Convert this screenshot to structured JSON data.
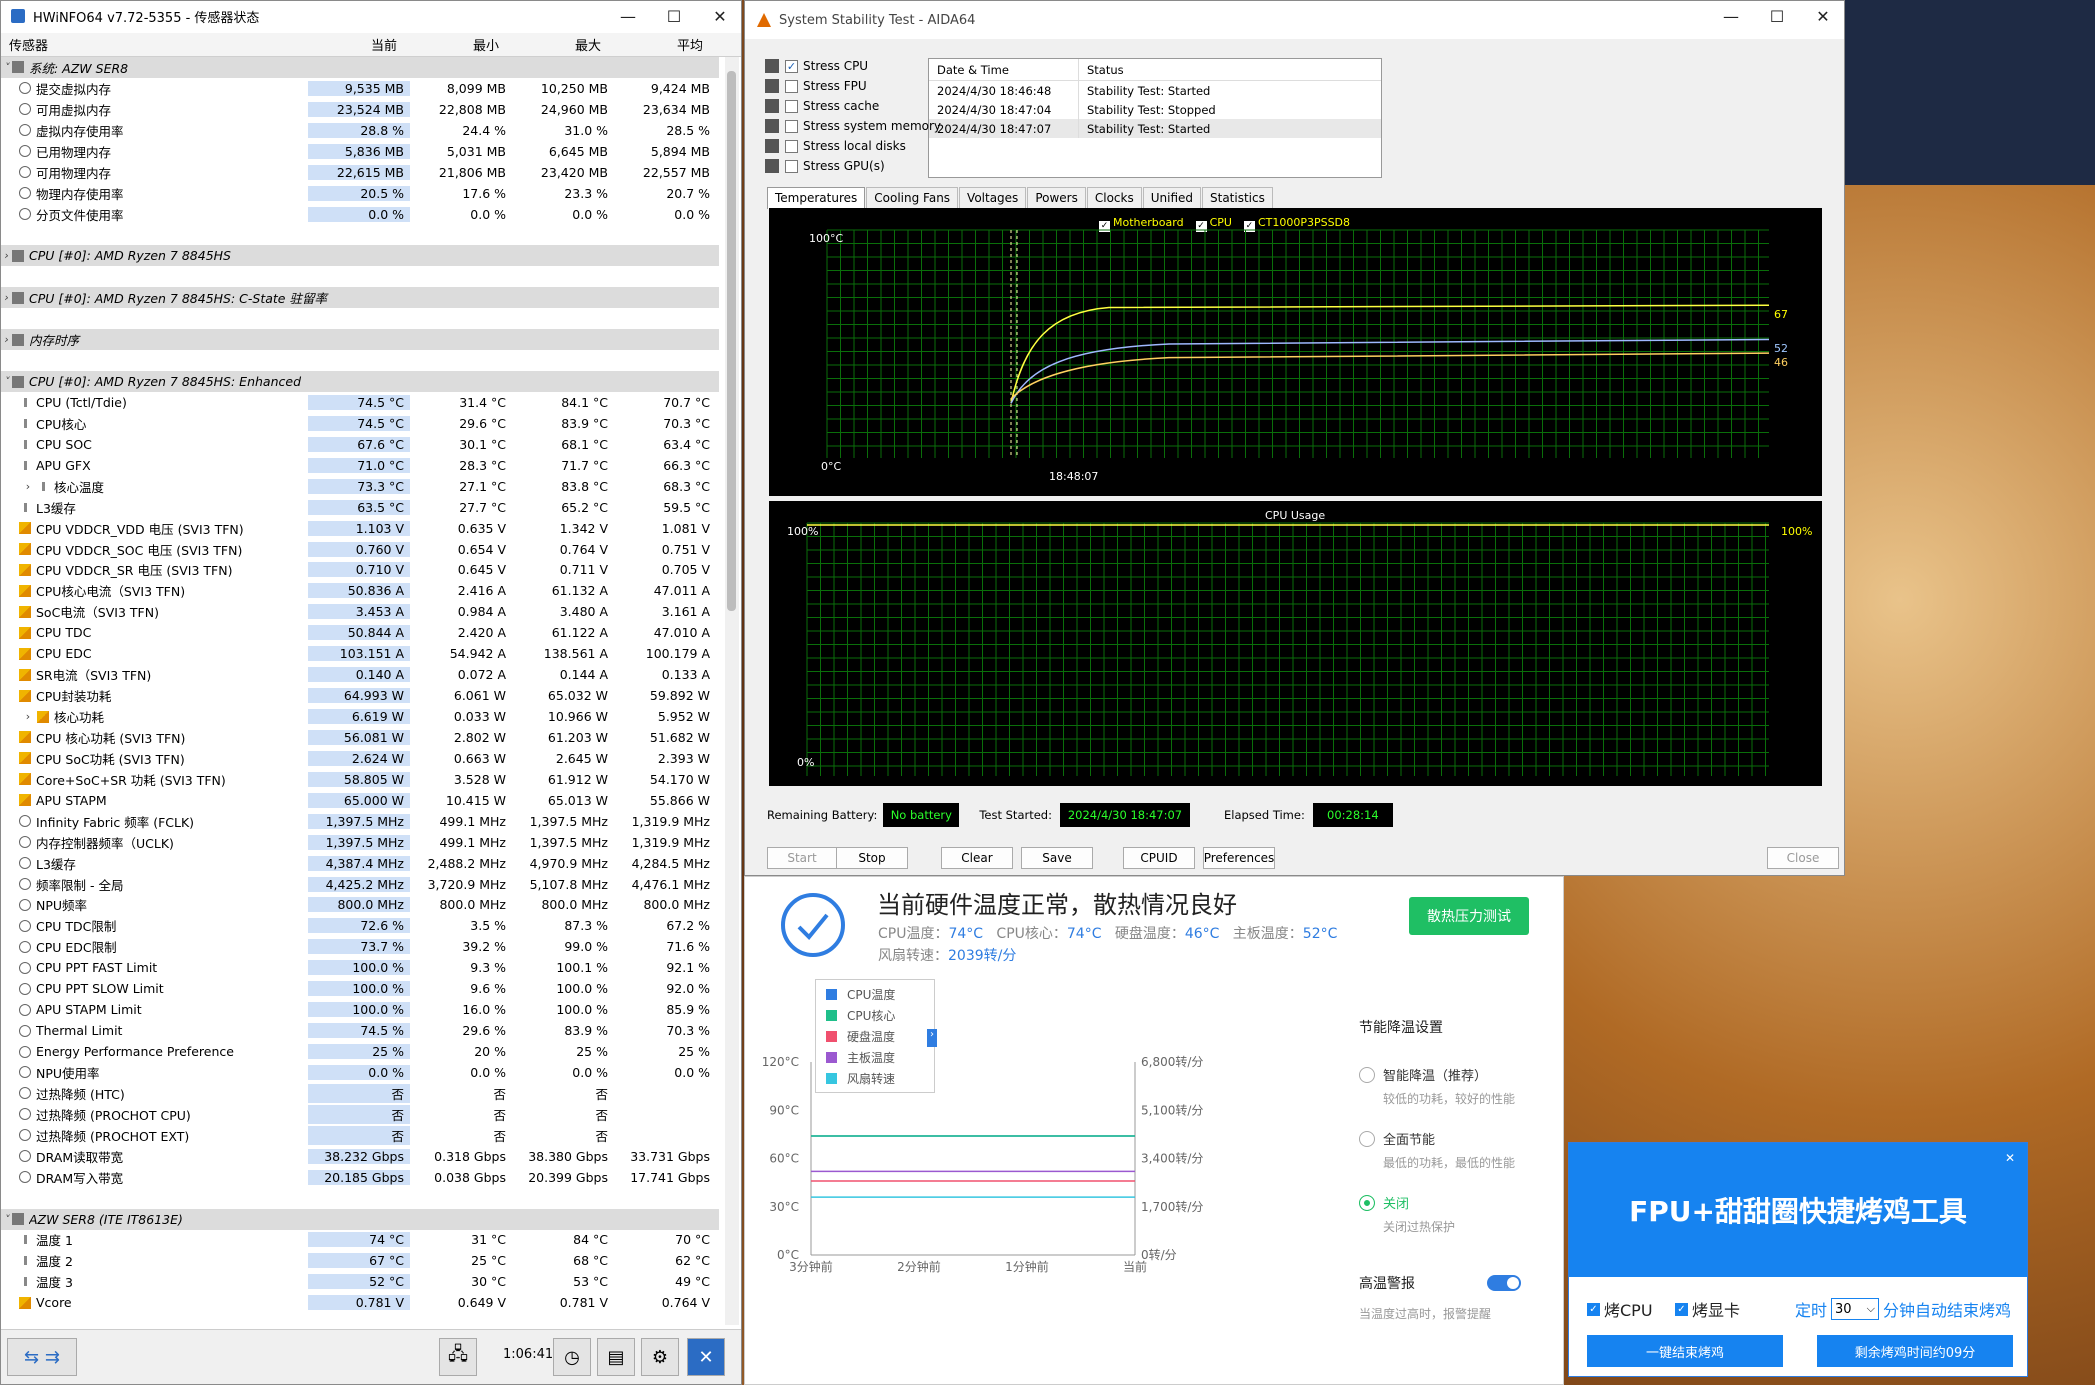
{
  "hwinfo": {
    "title": "HWiNFO64 v7.72-5355 - 传感器状态",
    "columns": {
      "sensor": "传感器",
      "current": "当前",
      "min": "最小",
      "max": "最大",
      "avg": "平均"
    },
    "rows": [
      {
        "type": "group",
        "expand": "˅",
        "name": "系统: AZW SER8"
      },
      {
        "type": "item",
        "icon": "circ",
        "name": "提交虚拟内存",
        "cur": "9,535 MB",
        "min": "8,099 MB",
        "max": "10,250 MB",
        "avg": "9,424 MB"
      },
      {
        "type": "item",
        "icon": "circ",
        "name": "可用虚拟内存",
        "cur": "23,524 MB",
        "min": "22,808 MB",
        "max": "24,960 MB",
        "avg": "23,634 MB"
      },
      {
        "type": "item",
        "icon": "circ",
        "name": "虚拟内存使用率",
        "cur": "28.8 %",
        "min": "24.4 %",
        "max": "31.0 %",
        "avg": "28.5 %"
      },
      {
        "type": "item",
        "icon": "circ",
        "name": "已用物理内存",
        "cur": "5,836 MB",
        "min": "5,031 MB",
        "max": "6,645 MB",
        "avg": "5,894 MB"
      },
      {
        "type": "item",
        "icon": "circ",
        "name": "可用物理内存",
        "cur": "22,615 MB",
        "min": "21,806 MB",
        "max": "23,420 MB",
        "avg": "22,557 MB"
      },
      {
        "type": "item",
        "icon": "circ",
        "name": "物理内存使用率",
        "cur": "20.5 %",
        "min": "17.6 %",
        "max": "23.3 %",
        "avg": "20.7 %"
      },
      {
        "type": "item",
        "icon": "circ",
        "name": "分页文件使用率",
        "cur": "0.0 %",
        "min": "0.0 %",
        "max": "0.0 %",
        "avg": "0.0 %"
      },
      {
        "type": "blank"
      },
      {
        "type": "group",
        "expand": "›",
        "name": "CPU [#0]: AMD Ryzen 7 8845HS"
      },
      {
        "type": "blank"
      },
      {
        "type": "group",
        "expand": "›",
        "name": "CPU [#0]: AMD Ryzen 7 8845HS: C-State 驻留率"
      },
      {
        "type": "blank"
      },
      {
        "type": "group",
        "expand": "›",
        "name": "内存时序"
      },
      {
        "type": "blank"
      },
      {
        "type": "group",
        "expand": "˅",
        "name": "CPU [#0]: AMD Ryzen 7 8845HS: Enhanced"
      },
      {
        "type": "item",
        "icon": "therm",
        "name": "CPU (Tctl/Tdie)",
        "cur": "74.5 °C",
        "min": "31.4 °C",
        "max": "84.1 °C",
        "avg": "70.7 °C"
      },
      {
        "type": "item",
        "icon": "therm",
        "name": "CPU核心",
        "cur": "74.5 °C",
        "min": "29.6 °C",
        "max": "83.9 °C",
        "avg": "70.3 °C"
      },
      {
        "type": "item",
        "icon": "therm",
        "name": "CPU SOC",
        "cur": "67.6 °C",
        "min": "30.1 °C",
        "max": "68.1 °C",
        "avg": "63.4 °C"
      },
      {
        "type": "item",
        "icon": "therm",
        "name": "APU GFX",
        "cur": "71.0 °C",
        "min": "28.3 °C",
        "max": "71.7 °C",
        "avg": "66.3 °C"
      },
      {
        "type": "item",
        "icon": "therm",
        "sub": true,
        "name": "核心温度",
        "cur": "73.3 °C",
        "min": "27.1 °C",
        "max": "83.8 °C",
        "avg": "68.3 °C"
      },
      {
        "type": "item",
        "icon": "therm",
        "name": "L3缓存",
        "cur": "63.5 °C",
        "min": "27.7 °C",
        "max": "65.2 °C",
        "avg": "59.5 °C"
      },
      {
        "type": "item",
        "icon": "bolt",
        "name": "CPU VDDCR_VDD 电压 (SVI3 TFN)",
        "cur": "1.103 V",
        "min": "0.635 V",
        "max": "1.342 V",
        "avg": "1.081 V"
      },
      {
        "type": "item",
        "icon": "bolt",
        "name": "CPU VDDCR_SOC 电压 (SVI3 TFN)",
        "cur": "0.760 V",
        "min": "0.654 V",
        "max": "0.764 V",
        "avg": "0.751 V"
      },
      {
        "type": "item",
        "icon": "bolt",
        "name": "CPU VDDCR_SR 电压 (SVI3 TFN)",
        "cur": "0.710 V",
        "min": "0.645 V",
        "max": "0.711 V",
        "avg": "0.705 V"
      },
      {
        "type": "item",
        "icon": "bolt",
        "name": "CPU核心电流（SVI3 TFN)",
        "cur": "50.836 A",
        "min": "2.416 A",
        "max": "61.132 A",
        "avg": "47.011 A"
      },
      {
        "type": "item",
        "icon": "bolt",
        "name": "SoC电流（SVI3 TFN)",
        "cur": "3.453 A",
        "min": "0.984 A",
        "max": "3.480 A",
        "avg": "3.161 A"
      },
      {
        "type": "item",
        "icon": "bolt",
        "name": "CPU TDC",
        "cur": "50.844 A",
        "min": "2.420 A",
        "max": "61.122 A",
        "avg": "47.010 A"
      },
      {
        "type": "item",
        "icon": "bolt",
        "name": "CPU EDC",
        "cur": "103.151 A",
        "min": "54.942 A",
        "max": "138.561 A",
        "avg": "100.179 A"
      },
      {
        "type": "item",
        "icon": "bolt",
        "name": "SR电流（SVI3 TFN)",
        "cur": "0.140 A",
        "min": "0.072 A",
        "max": "0.144 A",
        "avg": "0.133 A"
      },
      {
        "type": "item",
        "icon": "bolt",
        "name": "CPU封装功耗",
        "cur": "64.993 W",
        "min": "6.061 W",
        "max": "65.032 W",
        "avg": "59.892 W"
      },
      {
        "type": "item",
        "icon": "bolt",
        "sub": true,
        "name": "核心功耗",
        "cur": "6.619 W",
        "min": "0.033 W",
        "max": "10.966 W",
        "avg": "5.952 W"
      },
      {
        "type": "item",
        "icon": "bolt",
        "name": "CPU 核心功耗 (SVI3 TFN)",
        "cur": "56.081 W",
        "min": "2.802 W",
        "max": "61.203 W",
        "avg": "51.682 W"
      },
      {
        "type": "item",
        "icon": "bolt",
        "name": "CPU SoC功耗 (SVI3 TFN)",
        "cur": "2.624 W",
        "min": "0.663 W",
        "max": "2.645 W",
        "avg": "2.393 W"
      },
      {
        "type": "item",
        "icon": "bolt",
        "name": "Core+SoC+SR 功耗 (SVI3 TFN)",
        "cur": "58.805 W",
        "min": "3.528 W",
        "max": "61.912 W",
        "avg": "54.170 W"
      },
      {
        "type": "item",
        "icon": "bolt",
        "name": "APU STAPM",
        "cur": "65.000 W",
        "min": "10.415 W",
        "max": "65.013 W",
        "avg": "55.866 W"
      },
      {
        "type": "item",
        "icon": "circ",
        "name": "Infinity Fabric 频率 (FCLK)",
        "cur": "1,397.5 MHz",
        "min": "499.1 MHz",
        "max": "1,397.5 MHz",
        "avg": "1,319.9 MHz"
      },
      {
        "type": "item",
        "icon": "circ",
        "name": "内存控制器频率（UCLK)",
        "cur": "1,397.5 MHz",
        "min": "499.1 MHz",
        "max": "1,397.5 MHz",
        "avg": "1,319.9 MHz"
      },
      {
        "type": "item",
        "icon": "circ",
        "name": "L3缓存",
        "cur": "4,387.4 MHz",
        "min": "2,488.2 MHz",
        "max": "4,970.9 MHz",
        "avg": "4,284.5 MHz"
      },
      {
        "type": "item",
        "icon": "circ",
        "name": "频率限制 - 全局",
        "cur": "4,425.2 MHz",
        "min": "3,720.9 MHz",
        "max": "5,107.8 MHz",
        "avg": "4,476.1 MHz"
      },
      {
        "type": "item",
        "icon": "circ",
        "name": "NPU频率",
        "cur": "800.0 MHz",
        "min": "800.0 MHz",
        "max": "800.0 MHz",
        "avg": "800.0 MHz"
      },
      {
        "type": "item",
        "icon": "circ",
        "name": "CPU TDC限制",
        "cur": "72.6 %",
        "min": "3.5 %",
        "max": "87.3 %",
        "avg": "67.2 %"
      },
      {
        "type": "item",
        "icon": "circ",
        "name": "CPU EDC限制",
        "cur": "73.7 %",
        "min": "39.2 %",
        "max": "99.0 %",
        "avg": "71.6 %"
      },
      {
        "type": "item",
        "icon": "circ",
        "name": "CPU PPT FAST Limit",
        "cur": "100.0 %",
        "min": "9.3 %",
        "max": "100.1 %",
        "avg": "92.1 %"
      },
      {
        "type": "item",
        "icon": "circ",
        "name": "CPU PPT SLOW Limit",
        "cur": "100.0 %",
        "min": "9.6 %",
        "max": "100.0 %",
        "avg": "92.0 %"
      },
      {
        "type": "item",
        "icon": "circ",
        "name": "APU STAPM Limit",
        "cur": "100.0 %",
        "min": "16.0 %",
        "max": "100.0 %",
        "avg": "85.9 %"
      },
      {
        "type": "item",
        "icon": "circ",
        "name": "Thermal Limit",
        "cur": "74.5 %",
        "min": "29.6 %",
        "max": "83.9 %",
        "avg": "70.3 %"
      },
      {
        "type": "item",
        "icon": "circ",
        "name": "Energy Performance Preference",
        "cur": "25 %",
        "min": "20 %",
        "max": "25 %",
        "avg": "25 %"
      },
      {
        "type": "item",
        "icon": "circ",
        "name": "NPU使用率",
        "cur": "0.0 %",
        "min": "0.0 %",
        "max": "0.0 %",
        "avg": "0.0 %"
      },
      {
        "type": "item",
        "icon": "circ",
        "name": "过热降频 (HTC)",
        "cur": "否",
        "min": "否",
        "max": "否",
        "avg": ""
      },
      {
        "type": "item",
        "icon": "circ",
        "name": "过热降频 (PROCHOT CPU)",
        "cur": "否",
        "min": "否",
        "max": "否",
        "avg": ""
      },
      {
        "type": "item",
        "icon": "circ",
        "name": "过热降频 (PROCHOT EXT)",
        "cur": "否",
        "min": "否",
        "max": "否",
        "avg": ""
      },
      {
        "type": "item",
        "icon": "circ",
        "name": "DRAM读取带宽",
        "cur": "38.232 Gbps",
        "min": "0.318 Gbps",
        "max": "38.380 Gbps",
        "avg": "33.731 Gbps"
      },
      {
        "type": "item",
        "icon": "circ",
        "name": "DRAM写入带宽",
        "cur": "20.185 Gbps",
        "min": "0.038 Gbps",
        "max": "20.399 Gbps",
        "avg": "17.741 Gbps"
      },
      {
        "type": "blank"
      },
      {
        "type": "group",
        "expand": "˅",
        "name": "AZW SER8 (ITE IT8613E)"
      },
      {
        "type": "item",
        "icon": "therm",
        "name": "温度 1",
        "cur": "74 °C",
        "min": "31 °C",
        "max": "84 °C",
        "avg": "70 °C"
      },
      {
        "type": "item",
        "icon": "therm",
        "name": "温度 2",
        "cur": "67 °C",
        "min": "25 °C",
        "max": "68 °C",
        "avg": "62 °C"
      },
      {
        "type": "item",
        "icon": "therm",
        "name": "温度 3",
        "cur": "52 °C",
        "min": "30 °C",
        "max": "53 °C",
        "avg": "49 °C"
      },
      {
        "type": "item",
        "icon": "bolt",
        "name": "Vcore",
        "cur": "0.781 V",
        "min": "0.649 V",
        "max": "0.781 V",
        "avg": "0.764 V"
      }
    ],
    "elapsed": "1:06:41"
  },
  "aida": {
    "title": "System Stability Test - AIDA64",
    "stress": [
      {
        "label": "Stress CPU",
        "checked": true
      },
      {
        "label": "Stress FPU",
        "checked": false
      },
      {
        "label": "Stress cache",
        "checked": false
      },
      {
        "label": "Stress system memory",
        "checked": false
      },
      {
        "label": "Stress local disks",
        "checked": false
      },
      {
        "label": "Stress GPU(s)",
        "checked": false
      }
    ],
    "log_headers": {
      "date": "Date & Time",
      "status": "Status"
    },
    "log": [
      {
        "date": "2024/4/30 18:46:48",
        "status": "Stability Test: Started"
      },
      {
        "date": "2024/4/30 18:47:04",
        "status": "Stability Test: Stopped"
      },
      {
        "date": "2024/4/30 18:47:07",
        "status": "Stability Test: Started"
      }
    ],
    "tabs": [
      "Temperatures",
      "Cooling Fans",
      "Voltages",
      "Powers",
      "Clocks",
      "Unified",
      "Statistics"
    ],
    "temp_legend": [
      "Motherboard",
      "CPU",
      "CT1000P3PSSD8"
    ],
    "temp_top": "100°C",
    "temp_bottom": "0°C",
    "temp_time_label": "18:48:07",
    "temp_values": [
      "67",
      "52",
      "46"
    ],
    "usage_title": "CPU Usage",
    "usage_top": "100%",
    "usage_bottom": "0%",
    "usage_value": "100%",
    "battery_label": "Remaining Battery:",
    "battery_value": "No battery",
    "started_label": "Test Started:",
    "started_value": "2024/4/30 18:47:07",
    "elapsed_label": "Elapsed Time:",
    "elapsed_value": "00:28:14",
    "buttons": {
      "start": "Start",
      "stop": "Stop",
      "clear": "Clear",
      "save": "Save",
      "cpuid": "CPUID",
      "prefs": "Preferences",
      "close": "Close"
    }
  },
  "monitor": {
    "title": "当前硬件温度正常，散热情况良好",
    "cpu_temp_label": "CPU温度：",
    "cpu_temp": "74°C",
    "cpu_core_label": "CPU核心：",
    "cpu_core": "74°C",
    "disk_label": "硬盘温度：",
    "disk": "46°C",
    "board_label": "主板温度：",
    "board": "52°C",
    "fan_label": "风扇转速：",
    "fan": "2039转/分",
    "test_button": "散热压力测试",
    "legend": [
      {
        "name": "CPU温度",
        "color": "#2f7de1"
      },
      {
        "name": "CPU核心",
        "color": "#1fbf8a"
      },
      {
        "name": "硬盘温度",
        "color": "#f0506e"
      },
      {
        "name": "主板温度",
        "color": "#9b59d0"
      },
      {
        "name": "风扇转速",
        "color": "#36c6e0"
      }
    ],
    "y_left": [
      "120°C",
      "90°C",
      "60°C",
      "30°C",
      "0°C"
    ],
    "y_right": [
      "6,800转/分",
      "5,100转/分",
      "3,400转/分",
      "1,700转/分",
      "0转/分"
    ],
    "x": [
      "3分钟前",
      "2分钟前",
      "1分钟前",
      "当前"
    ],
    "section_title": "节能降温设置",
    "options": [
      {
        "title": "智能降温（推荐）",
        "desc": "较低的功耗，较好的性能"
      },
      {
        "title": "全面节能",
        "desc": "最低的功耗，最低的性能"
      },
      {
        "title": "关闭",
        "desc": "关闭过热保护"
      }
    ],
    "alarm_title": "高温警报",
    "alarm_desc": "当温度过高时，报警提醒"
  },
  "fpu": {
    "title": "FPU+甜甜圈快捷烤鸡工具",
    "cb_cpu": "烤CPU",
    "cb_gpu": "烤显卡",
    "timer_label": "定时",
    "timer_value": "30",
    "timer_suffix": "分钟自动结束烤鸡",
    "btn_end": "一键结束烤鸡",
    "btn_remaining": "剩余烤鸡时间约09分"
  }
}
